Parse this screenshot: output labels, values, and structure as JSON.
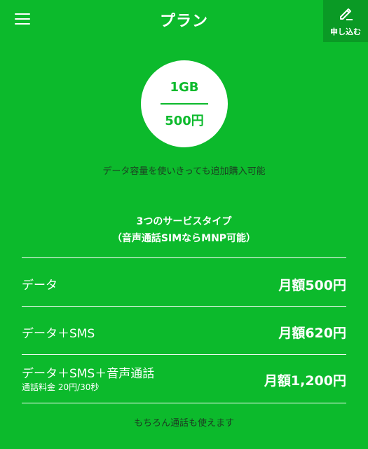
{
  "header": {
    "title": "プラン",
    "apply_label": "申し込む"
  },
  "plan": {
    "data_amount": "1GB",
    "price": "500円"
  },
  "note_top": "データ容量を使いきっても追加購入可能",
  "service_heading": {
    "line1": "3つのサービスタイプ",
    "line2": "（音声通話SIMならMNP可能）"
  },
  "service_types": [
    {
      "name": "データ",
      "sub": "",
      "price": "月額500円"
    },
    {
      "name": "データ＋SMS",
      "sub": "",
      "price": "月額620円"
    },
    {
      "name": "データ＋SMS＋音声通話",
      "sub": "通話料金 20円/30秒",
      "price": "月額1,200円"
    }
  ],
  "note_bottom": "もちろん通話も使えます",
  "icons": {
    "menu": "hamburger-menu-icon",
    "apply": "pencil-icon"
  },
  "colors": {
    "background": "#0cba2c",
    "apply_button": "#0a9a25",
    "note_text": "#1c3d22",
    "circle": "#ffffff"
  }
}
